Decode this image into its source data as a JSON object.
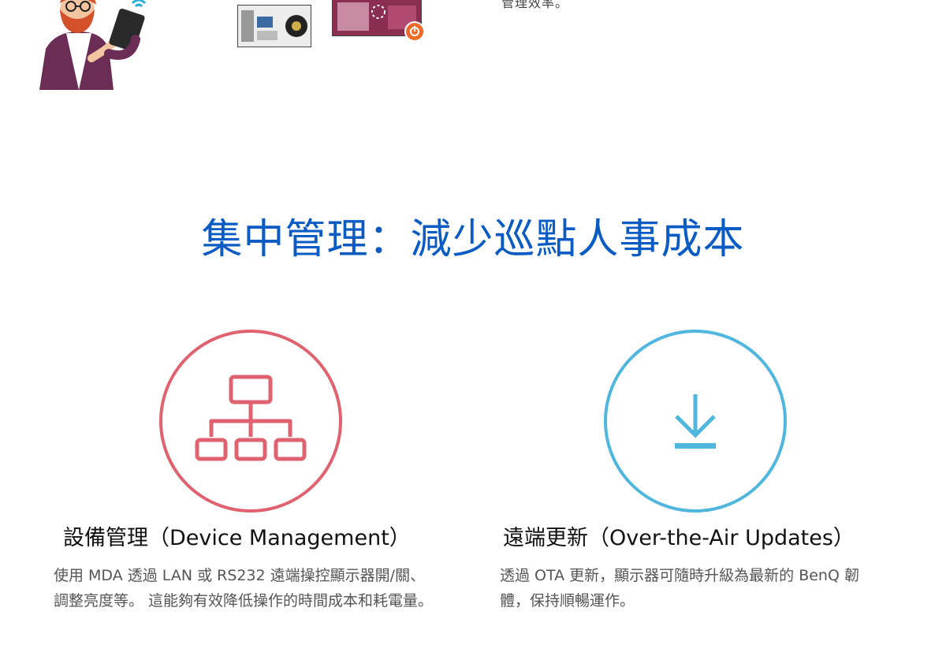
{
  "top_strip": {
    "cropped_text": "管理效率。"
  },
  "section": {
    "title": "集中管理：減少巡點人事成本"
  },
  "features": [
    {
      "title": "設備管理（Device Management）",
      "description": "使用 MDA 透過 LAN 或 RS232 遠端操控顯示器開/關、調整亮度等。 這能夠有效降低操作的時間成本和耗電量。",
      "icon": "sitemap-icon",
      "color": "#e0626f"
    },
    {
      "title": "遠端更新（Over-the-Air Updates）",
      "description": "透過 OTA 更新，顯示器可隨時升級為最新的 BenQ 韌體，保持順暢運作。",
      "icon": "download-icon",
      "color": "#4fb6de"
    }
  ],
  "colors": {
    "heading": "#0a5bc4",
    "body_text": "#555555"
  }
}
